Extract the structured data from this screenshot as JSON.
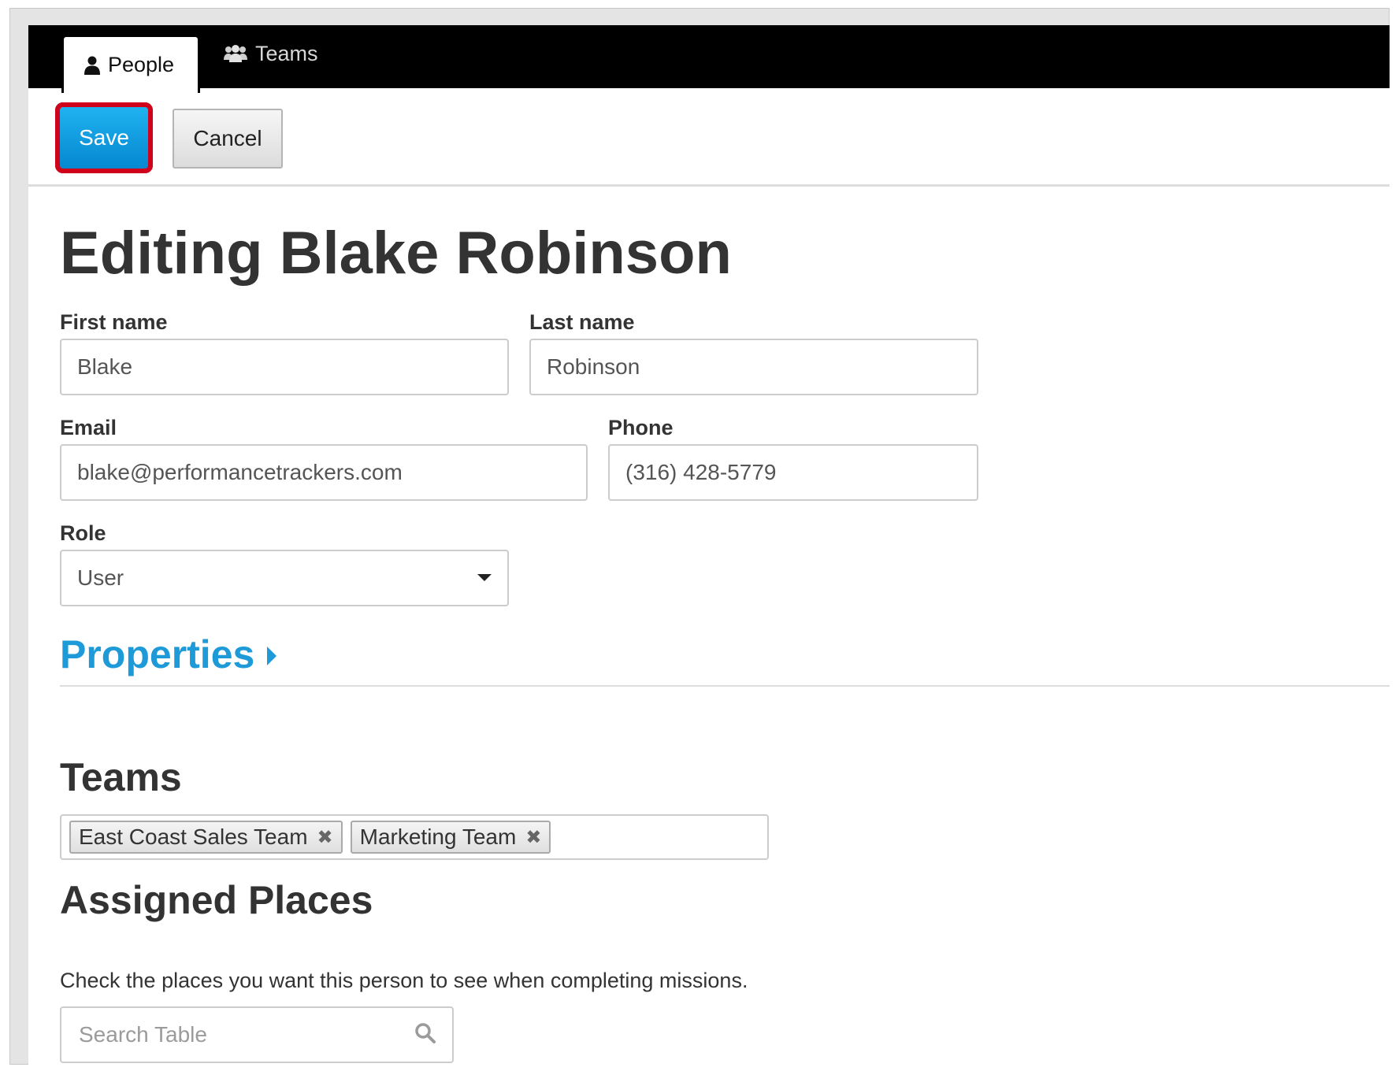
{
  "nav": {
    "tabs": [
      {
        "label": "People",
        "icon": "person-icon",
        "active": true
      },
      {
        "label": "Teams",
        "icon": "group-icon",
        "active": false
      }
    ]
  },
  "toolbar": {
    "save_label": "Save",
    "cancel_label": "Cancel",
    "save_color": "#0b9ee3",
    "highlight_color": "#d0021b"
  },
  "page": {
    "title": "Editing Blake Robinson"
  },
  "form": {
    "first_name": {
      "label": "First name",
      "value": "Blake"
    },
    "last_name": {
      "label": "Last name",
      "value": "Robinson"
    },
    "email": {
      "label": "Email",
      "value": "blake@performancetrackers.com"
    },
    "phone": {
      "label": "Phone",
      "value": "(316) 428-5779"
    },
    "role": {
      "label": "Role",
      "value": "User"
    }
  },
  "properties": {
    "label": "Properties",
    "color": "#1e9ad9"
  },
  "teams": {
    "heading": "Teams",
    "tags": [
      "East Coast Sales Team",
      "Marketing Team"
    ],
    "remove_glyph": "✖"
  },
  "assigned_places": {
    "heading": "Assigned Places",
    "help_text": "Check the places you want this person to see when completing missions.",
    "search_placeholder": "Search Table"
  }
}
